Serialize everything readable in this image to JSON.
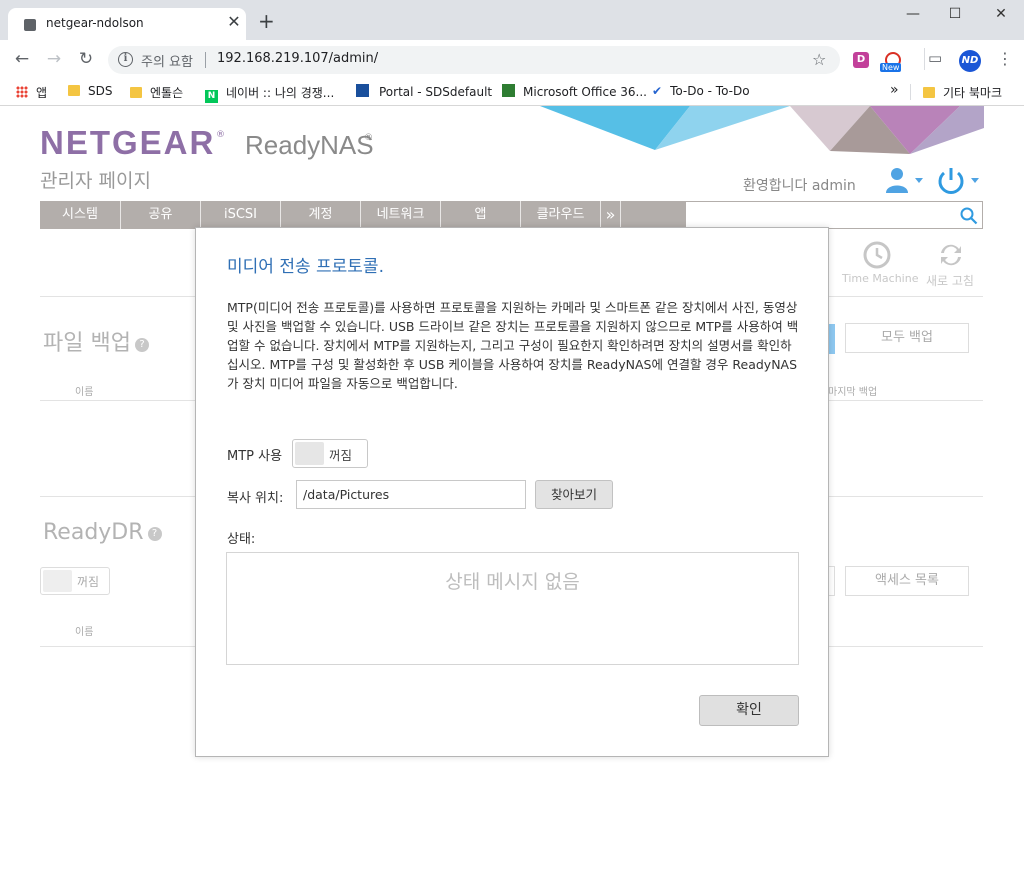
{
  "browser": {
    "tab_title": "netgear-ndolson",
    "address_warning": "주의 요함",
    "url": "192.168.219.107/admin/",
    "bookmarks": [
      {
        "label": "앱"
      },
      {
        "label": "SDS"
      },
      {
        "label": "엔톨슨"
      },
      {
        "label": "네이버 :: 나의 경쟁..."
      },
      {
        "label": "Portal - SDSdefault"
      },
      {
        "label": "Microsoft Office 36..."
      },
      {
        "label": "To-Do - To-Do"
      },
      {
        "label": "기타 북마크"
      }
    ],
    "avatar_initials": "ND",
    "new_badge": "New"
  },
  "header": {
    "logo": "NETGEAR",
    "product": "ReadyNAS",
    "subtitle": "관리자 페이지",
    "welcome": "환영합니다 admin"
  },
  "menu": {
    "items": [
      "시스템",
      "공유",
      "iSCSI",
      "계정",
      "네트워크",
      "앱",
      "클라우드"
    ],
    "more": "»"
  },
  "background": {
    "time_machine": "Time Machine",
    "refresh": "새로 고침",
    "file_backup_title": "파일 백업",
    "backup_all": "모두 백업",
    "col_name": "이름",
    "col_last_backup": "마지막 백업",
    "readydr_title": "ReadyDR",
    "readydr_toggle": "꺼짐",
    "access_list": "액세스 목록",
    "col_name2": "이름"
  },
  "modal": {
    "title": "미디어 전송 프로토콜.",
    "description": "MTP(미디어 전송 프로토콜)를 사용하면 프로토콜을 지원하는 카메라 및 스마트폰 같은 장치에서 사진, 동영상 및 사진을 백업할 수 있습니다. USB 드라이브 같은 장치는 프로토콜을 지원하지 않으므로 MTP를 사용하여 백업할 수 없습니다. 장치에서 MTP를 지원하는지, 그리고 구성이 필요한지 확인하려면 장치의 설명서를 확인하십시오. MTP를 구성 및 활성화한 후 USB 케이블을 사용하여 장치를 ReadyNAS에 연결할 경우 ReadyNAS가 장치 미디어 파일을 자동으로 백업합니다.",
    "mtp_label": "MTP 사용",
    "mtp_toggle": "꺼짐",
    "copy_label": "복사 위치:",
    "copy_path": "/data/Pictures",
    "browse_label": "찾아보기",
    "status_label": "상태:",
    "status_empty": "상태 메시지 없음",
    "ok_label": "확인"
  },
  "colors": {
    "brand_purple": "#8e6fa6",
    "menu_gray": "#b3aeab",
    "accent_blue": "#2f9ae0",
    "title_blue": "#2f6fb5"
  }
}
